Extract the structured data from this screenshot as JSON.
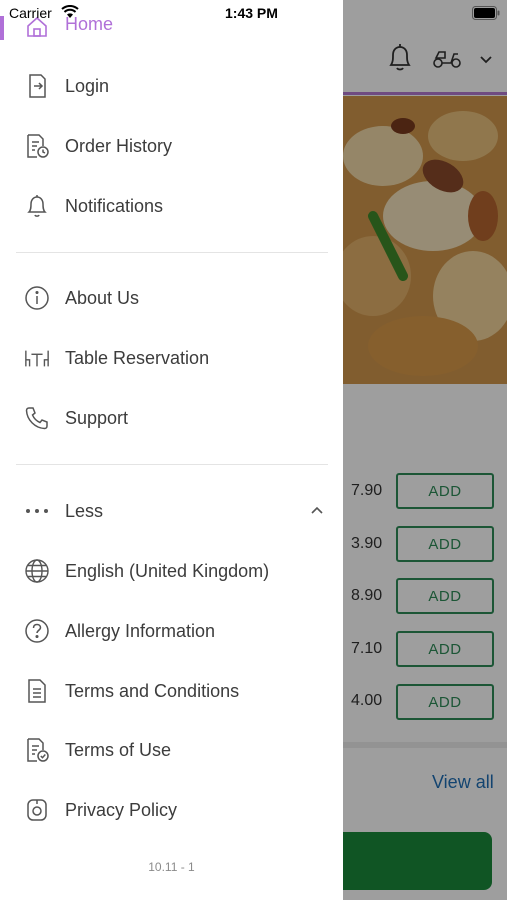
{
  "status_bar": {
    "carrier": "Carrier",
    "time": "1:43 PM"
  },
  "menu": {
    "home": "Home",
    "login": "Login",
    "order_history": "Order History",
    "notifications": "Notifications",
    "about_us": "About Us",
    "table_reservation": "Table Reservation",
    "support": "Support",
    "less": "Less",
    "language": "English (United Kingdom)",
    "allergy": "Allergy Information",
    "terms_conditions": "Terms and Conditions",
    "terms_of_use": "Terms of Use",
    "privacy_policy": "Privacy Policy"
  },
  "version": "10.11 - 1",
  "background_app": {
    "prices": [
      "7.90",
      "3.90",
      "8.90",
      "7.10",
      "4.00"
    ],
    "add_label": "ADD",
    "view_all": "View all"
  },
  "colors": {
    "accent": "#b070d8",
    "add_green": "#2e8b57",
    "link_blue": "#1f6fb5",
    "cta_green": "#1b8a3a"
  }
}
